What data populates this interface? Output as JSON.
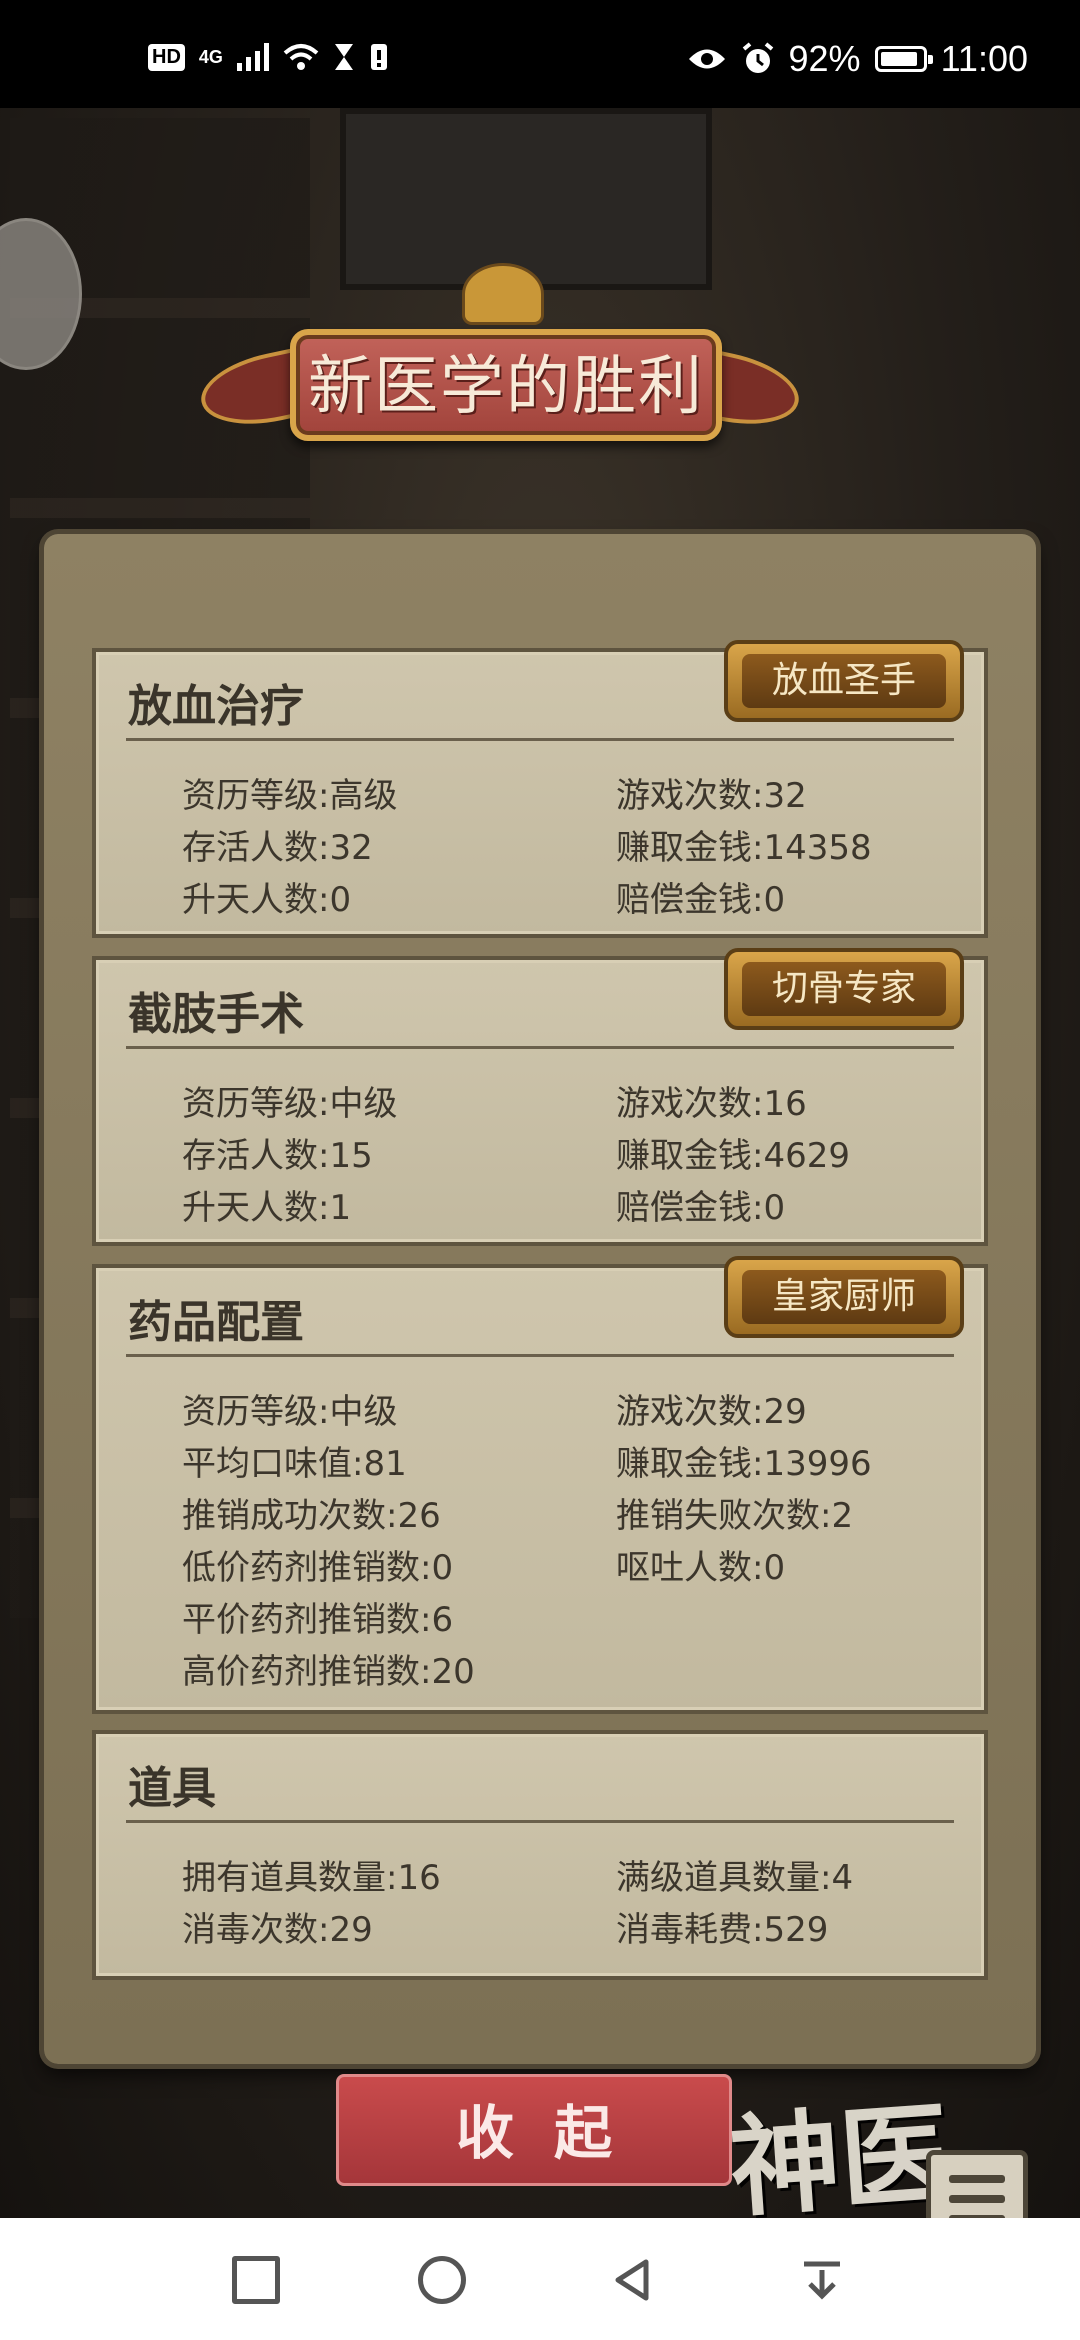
{
  "status_bar": {
    "hd": "HD",
    "network": "4G",
    "battery_percent": "92%",
    "time": "11:00",
    "battery_level": 0.92
  },
  "banner": {
    "title": "新医学的胜利"
  },
  "sections": [
    {
      "title": "放血治疗",
      "badge": "放血圣手",
      "stats": [
        {
          "label": "资历等级:",
          "value": "高级"
        },
        {
          "label": "游戏次数:",
          "value": "32"
        },
        {
          "label": "存活人数:",
          "value": "32"
        },
        {
          "label": "赚取金钱:",
          "value": "14358"
        },
        {
          "label": "升天人数:",
          "value": "0"
        },
        {
          "label": "赔偿金钱:",
          "value": "0"
        }
      ]
    },
    {
      "title": "截肢手术",
      "badge": "切骨专家",
      "stats": [
        {
          "label": "资历等级:",
          "value": "中级"
        },
        {
          "label": "游戏次数:",
          "value": "16"
        },
        {
          "label": "存活人数:",
          "value": "15"
        },
        {
          "label": "赚取金钱:",
          "value": "4629"
        },
        {
          "label": "升天人数:",
          "value": "1"
        },
        {
          "label": "赔偿金钱:",
          "value": "0"
        }
      ]
    },
    {
      "title": "药品配置",
      "badge": "皇家厨师",
      "stats": [
        {
          "label": "资历等级:",
          "value": "中级"
        },
        {
          "label": "游戏次数:",
          "value": "29"
        },
        {
          "label": "平均口味值:",
          "value": "81"
        },
        {
          "label": "赚取金钱:",
          "value": "13996"
        },
        {
          "label": "推销成功次数:",
          "value": "26"
        },
        {
          "label": "推销失败次数:",
          "value": "2"
        },
        {
          "label": "低价药剂推销数:",
          "value": "0"
        },
        {
          "label": "呕吐人数:",
          "value": "0"
        },
        {
          "label": "平价药剂推销数:",
          "value": "6"
        },
        {
          "label": "高价药剂推销数:",
          "value": "20"
        }
      ]
    },
    {
      "title": "道具",
      "stats": [
        {
          "label": "拥有道具数量:",
          "value": "16"
        },
        {
          "label": "满级道具数量:",
          "value": "4"
        },
        {
          "label": "消毒次数:",
          "value": "29"
        },
        {
          "label": "消毒耗费:",
          "value": "529"
        }
      ]
    }
  ],
  "collapse_button": "收起",
  "logo_text": "神医",
  "icons": [
    "eye-icon",
    "alarm-icon",
    "wifi-icon",
    "hourglass-icon",
    "sim-icon",
    "menu-icon",
    "nav-square-icon",
    "nav-circle-icon",
    "nav-back-icon",
    "nav-down-icon"
  ]
}
